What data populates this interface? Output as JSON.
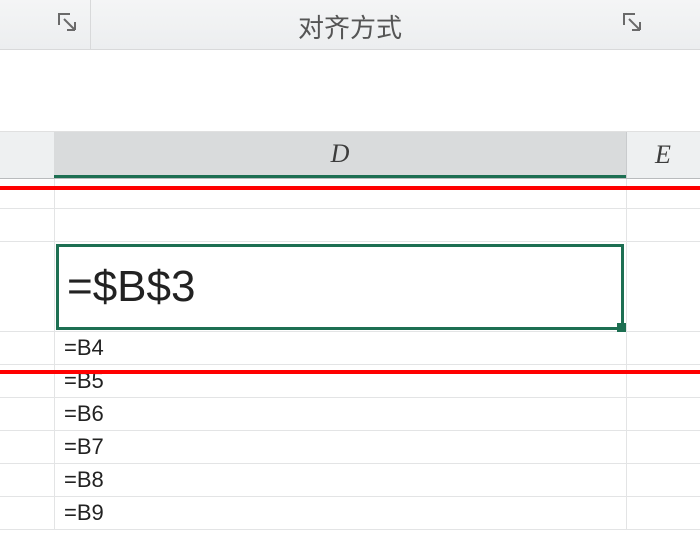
{
  "ribbon": {
    "group_label": "对齐方式"
  },
  "columns": {
    "D": "D",
    "E": "E"
  },
  "cells": {
    "selected": "=$B$3",
    "rows": [
      "=B4",
      "=B5",
      "=B6",
      "=B7",
      "=B8",
      "=B9"
    ]
  }
}
